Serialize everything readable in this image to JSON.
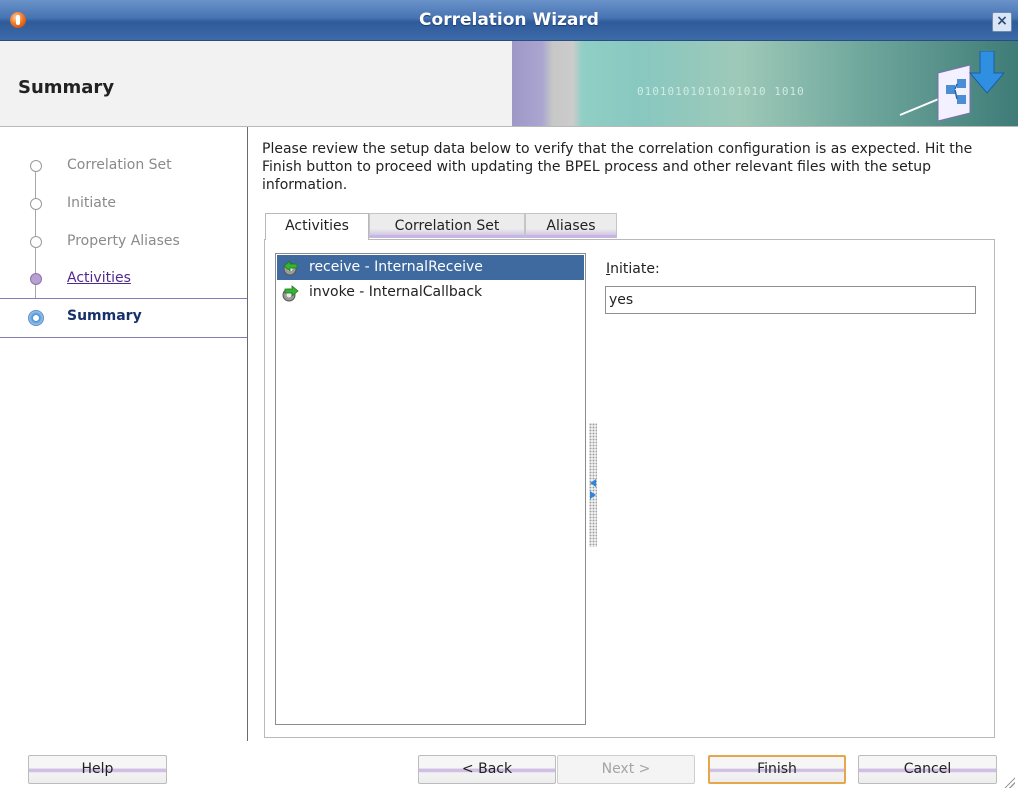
{
  "window": {
    "title": "Correlation Wizard",
    "close_glyph": "×"
  },
  "header": {
    "page_title": "Summary",
    "banner_bits": "01010101010101010 1010"
  },
  "steps": [
    {
      "label": "Correlation Set",
      "state": "pending"
    },
    {
      "label": "Initiate",
      "state": "pending"
    },
    {
      "label": "Property Aliases",
      "state": "pending"
    },
    {
      "label": "Activities",
      "state": "visited"
    },
    {
      "label": "Summary",
      "state": "current"
    }
  ],
  "intro_text": "Please review the setup data below to verify that the correlation configuration is as expected. Hit the Finish button to proceed with updating the BPEL process and other relevant files with the setup information.",
  "tabs": [
    {
      "label": "Activities",
      "active": true
    },
    {
      "label": "Correlation Set",
      "active": false
    },
    {
      "label": "Aliases",
      "active": false
    }
  ],
  "activities": [
    {
      "label": "receive - InternalReceive",
      "icon": "receive-activity-icon",
      "selected": true
    },
    {
      "label": "invoke - InternalCallback",
      "icon": "invoke-activity-icon",
      "selected": false
    }
  ],
  "detail": {
    "initiate_label": "Initiate:",
    "initiate_value": "yes"
  },
  "buttons": {
    "help": "Help",
    "back": "< Back",
    "next": "Next >",
    "finish": "Finish",
    "cancel": "Cancel"
  },
  "colors": {
    "titlebar": "#4673b2",
    "selection": "#3e6aa0",
    "step_visited": "#4f2a8c",
    "step_current": "#17326b",
    "default_button_border": "#e6a64a"
  }
}
